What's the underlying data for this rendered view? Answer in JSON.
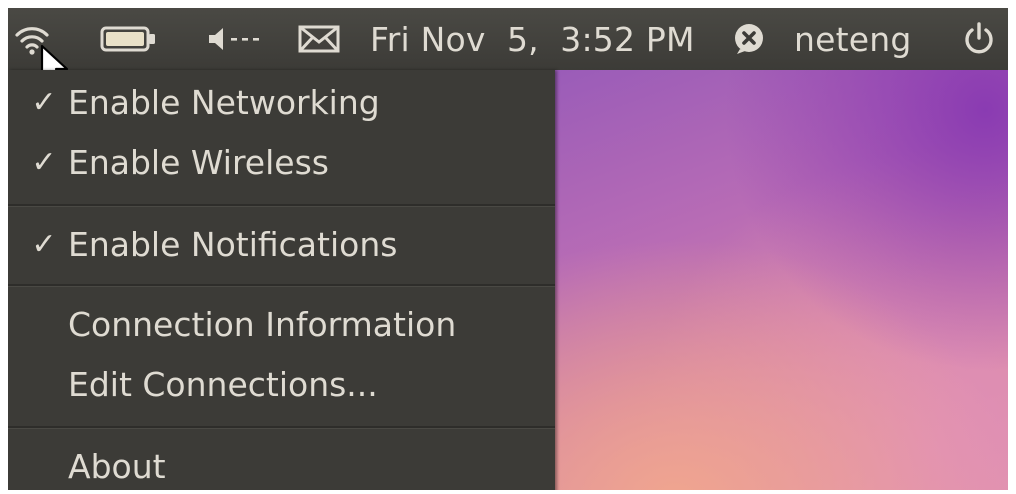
{
  "panel": {
    "network_icon": "wifi-icon",
    "battery_icon": "battery-icon",
    "volume_icon": "volume-muted-icon",
    "mail_icon": "mail-icon",
    "datetime": "Fri Nov  5,  3:52 PM",
    "chat_icon": "chat-offline-icon",
    "username": "neteng",
    "power_icon": "power-icon"
  },
  "menu": {
    "items": [
      {
        "label": "Enable Networking",
        "checked": true
      },
      {
        "label": "Enable Wireless",
        "checked": true
      },
      {
        "label": "Enable Notifications",
        "checked": true
      },
      {
        "label": "Connection Information",
        "checked": false
      },
      {
        "label": "Edit Connections...",
        "checked": false
      },
      {
        "label": "About",
        "checked": false
      }
    ],
    "check_glyph": "✓"
  },
  "colors": {
    "panel_bg": "#3c3b37",
    "text": "#dfdbd2",
    "wallpaper_accent": "#9a5cb8"
  }
}
